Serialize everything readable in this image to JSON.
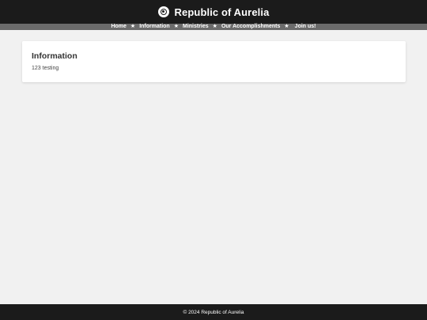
{
  "header": {
    "site_title": "Republic of Aurelia",
    "logo_icon": "emblem-icon"
  },
  "nav": {
    "separator": "★",
    "items": [
      {
        "label": "Home"
      },
      {
        "label": "Information"
      },
      {
        "label": "Ministries"
      },
      {
        "label": "Our Accomplishments"
      },
      {
        "label": "Join us!"
      }
    ]
  },
  "main": {
    "card_title": "Information",
    "card_text": "123 testing"
  },
  "footer": {
    "text": "© 2024 Republic of Aurelia"
  },
  "colors": {
    "header_bg": "#1b1b1b",
    "nav_bg": "#6b6b6b",
    "page_bg": "#f1f1f1",
    "card_bg": "#ffffff"
  }
}
